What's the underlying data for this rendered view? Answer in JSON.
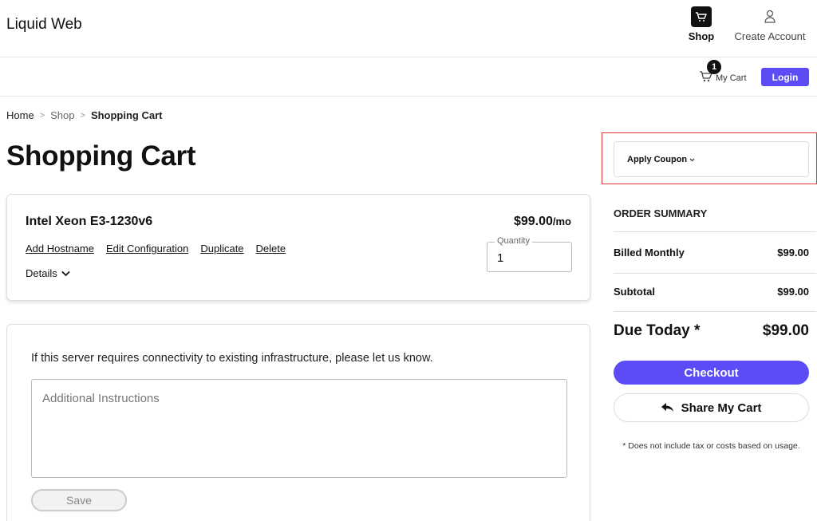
{
  "brand": "Liquid Web",
  "nav": {
    "shop_label": "Shop",
    "account_label": "Create Account"
  },
  "cart": {
    "count": "1",
    "label": "My Cart"
  },
  "login_label": "Login",
  "breadcrumb": {
    "home": "Home",
    "shop": "Shop",
    "current": "Shopping Cart",
    "separator": ">"
  },
  "page_title": "Shopping Cart",
  "item": {
    "name": "Intel Xeon E3-1230v6",
    "price": "$99.00",
    "per": "/mo",
    "actions": [
      "Add Hostname",
      "Edit Configuration",
      "Duplicate",
      "Delete"
    ],
    "details_label": "Details",
    "quantity_label": "Quantity",
    "quantity_value": "1"
  },
  "instructions": {
    "prompt": "If this server requires connectivity to existing infrastructure, please let us know.",
    "placeholder": "Additional Instructions",
    "save_label": "Save"
  },
  "coupon_label": "Apply Coupon",
  "summary": {
    "title": "ORDER SUMMARY",
    "billed_label": "Billed Monthly",
    "billed_value": "$99.00",
    "subtotal_label": "Subtotal",
    "subtotal_value": "$99.00",
    "due_label": "Due Today *",
    "due_value": "$99.00",
    "checkout_label": "Checkout",
    "share_label": "Share My Cart",
    "note": "* Does not include tax or costs based on usage."
  },
  "colors": {
    "accent": "#5b4cf5",
    "highlight": "#e53935"
  },
  "icons": {
    "shop": "cart-icon",
    "account": "user-icon",
    "cart": "cart-icon",
    "details": "chevron-down-icon",
    "coupon": "chevron-down-icon",
    "share": "reply-arrow-icon"
  }
}
